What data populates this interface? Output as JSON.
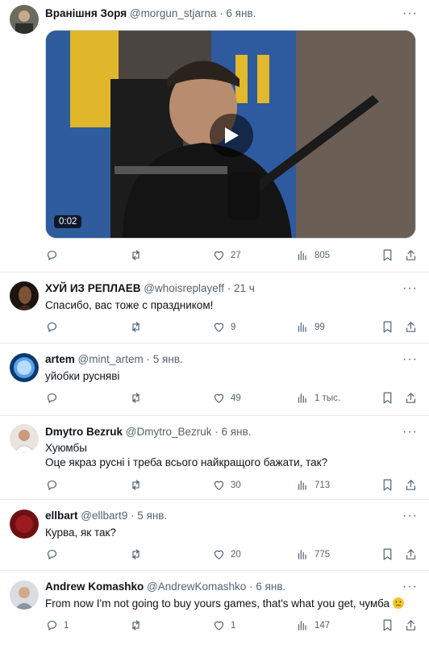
{
  "tweets": [
    {
      "name": "Вранішня Зоря",
      "handle": "@morgun_stjarna",
      "time": "· 6 янв.",
      "video_duration": "0:02",
      "replies": "",
      "retweets": "",
      "likes": "27",
      "views": "805"
    },
    {
      "name": "ХУЙ ИЗ РЕПЛАЕВ",
      "handle": "@whoisreplayeff",
      "time": "· 21 ч",
      "text": "Спасибо, вас тоже с праздником!",
      "replies": "",
      "retweets": "",
      "likes": "9",
      "views": "99"
    },
    {
      "name": "artem",
      "handle": "@mint_artem",
      "time": "· 5 янв.",
      "text": "уйобки русняві",
      "replies": "",
      "retweets": "",
      "likes": "49",
      "views": "1 тыс."
    },
    {
      "name": "Dmytro Bezruk",
      "handle": "@Dmytro_Bezruk",
      "time": "· 6 янв.",
      "text_line1": "Хуюмбы",
      "text_line2": "Оце якраз русні і треба всього найкращого бажати, так?",
      "replies": "",
      "retweets": "",
      "likes": "30",
      "views": "713"
    },
    {
      "name": "ellbart",
      "handle": "@ellbart9",
      "time": "· 5 янв.",
      "text": "Курва, як так?",
      "replies": "",
      "retweets": "",
      "likes": "20",
      "views": "775"
    },
    {
      "name": "Andrew Komashko",
      "handle": "@AndrewKomashko",
      "time": "· 6 янв.",
      "text": "From now I'm not going to buy yours games, that's what you get,  чумба",
      "replies": "1",
      "retweets": "",
      "likes": "1",
      "views": "147"
    }
  ],
  "more_label": "···",
  "colors": {
    "text": "#0f1419",
    "secondary": "#536471",
    "border": "#e7e9ea"
  },
  "icons": [
    "reply-icon",
    "retweet-icon",
    "like-icon",
    "views-icon",
    "bookmark-icon",
    "share-icon",
    "play-icon"
  ]
}
